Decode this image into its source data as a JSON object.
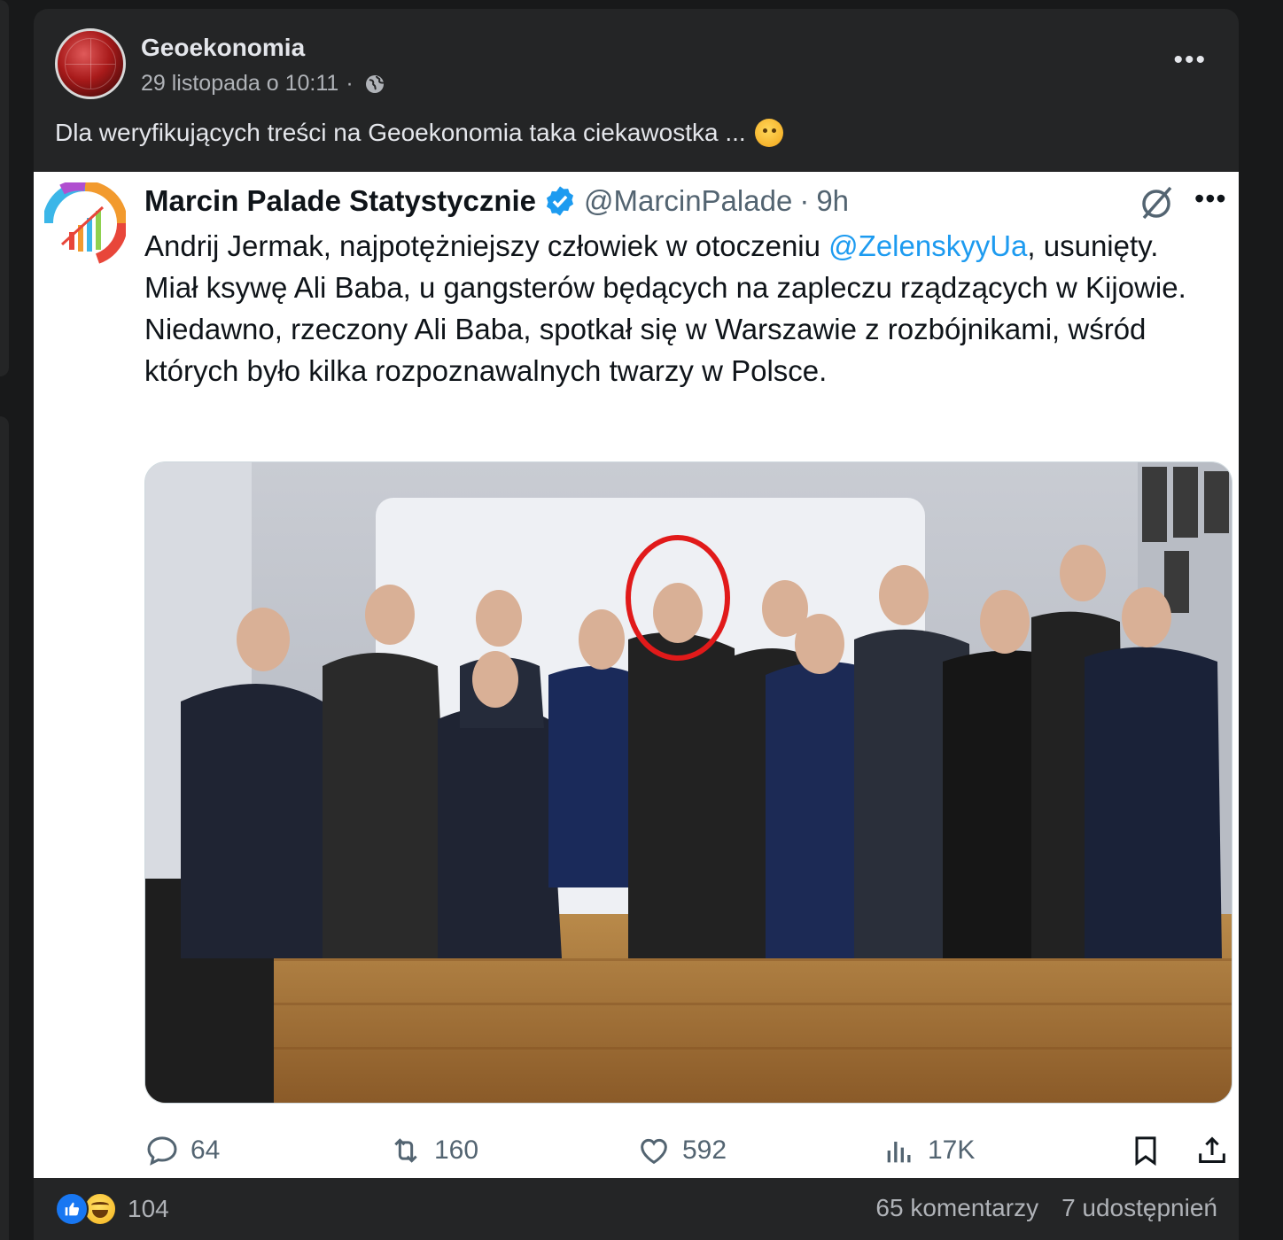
{
  "post": {
    "page_name": "Geoekonomia",
    "date": "29 listopada o 10:11",
    "separator": "·",
    "caption": "Dla weryfikujących treści na Geoekonomia taka ciekawostka ...",
    "more_icon": "more-horizontal-icon",
    "audience_icon": "globe-icon"
  },
  "tweet": {
    "name": "Marcin Palade Statystycznie",
    "handle": "@MarcinPalade",
    "dot": "·",
    "time": "9h",
    "text_before": "Andrij Jermak, najpotężniejszy człowiek w otoczeniu ",
    "mention": "@ZelenskyyUa",
    "text_after": ", usunięty. Miał ksywę Ali Baba, u gangsterów będących na zapleczu rządzących w Kijowie. Niedawno, rzeczony Ali Baba, spotkał się w Warszawie z rozbójnikami, wśród których było kilka rozpoznawalnych twarzy w Polsce.",
    "accent": "#1d9bf0",
    "actions": {
      "replies": "64",
      "retweets": "160",
      "likes": "592",
      "views": "17K"
    }
  },
  "footer": {
    "reaction_count": "104",
    "comments": "65 komentarzy",
    "shares": "7 udostępnień"
  }
}
